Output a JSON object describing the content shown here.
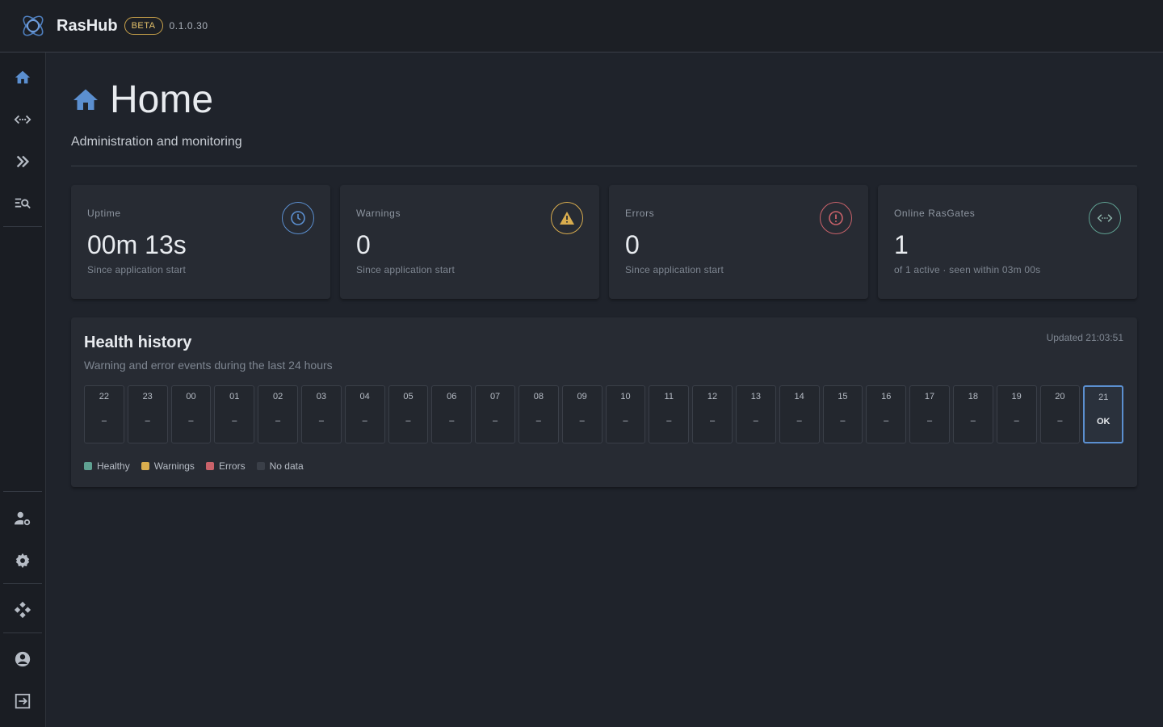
{
  "app": {
    "name": "RasHub",
    "badge": "BETA",
    "version": "0.1.0.30"
  },
  "sidebar": {
    "items": [
      {
        "icon": "home-icon",
        "name": "Home"
      },
      {
        "icon": "gateway-icon",
        "name": "Gateways"
      },
      {
        "icon": "double-chevron-right-icon",
        "name": "Forwarding"
      },
      {
        "icon": "log-search-icon",
        "name": "Logs"
      },
      {
        "icon": "user-settings-icon",
        "name": "User management"
      },
      {
        "icon": "gear-icon",
        "name": "Settings"
      },
      {
        "icon": "hub-network-icon",
        "name": "Network"
      },
      {
        "icon": "account-icon",
        "name": "Account"
      },
      {
        "icon": "logout-icon",
        "name": "Logout"
      }
    ],
    "active_index": 0
  },
  "page": {
    "title": "Home",
    "subtitle": "Administration and monitoring"
  },
  "cards": [
    {
      "label": "Uptime",
      "value": "00m 13s",
      "sub": "Since application start",
      "icon": "clock-icon",
      "color": "#5b8fd0"
    },
    {
      "label": "Warnings",
      "value": "0",
      "sub": "Since application start",
      "icon": "warning-icon",
      "color": "#d9ad4e"
    },
    {
      "label": "Errors",
      "value": "0",
      "sub": "Since application start",
      "icon": "error-icon",
      "color": "#c9626a"
    },
    {
      "label": "Online RasGates",
      "value": "1",
      "sub": "of 1 active · seen within 03m 00s",
      "icon": "gateway-icon",
      "color": "#5fa192"
    }
  ],
  "health": {
    "title": "Health history",
    "subtitle": "Warning and error events during the last 24 hours",
    "updated": "Updated 21:03:51",
    "hours": [
      {
        "hour": "22",
        "status": "–"
      },
      {
        "hour": "23",
        "status": "–"
      },
      {
        "hour": "00",
        "status": "–"
      },
      {
        "hour": "01",
        "status": "–"
      },
      {
        "hour": "02",
        "status": "–"
      },
      {
        "hour": "03",
        "status": "–"
      },
      {
        "hour": "04",
        "status": "–"
      },
      {
        "hour": "05",
        "status": "–"
      },
      {
        "hour": "06",
        "status": "–"
      },
      {
        "hour": "07",
        "status": "–"
      },
      {
        "hour": "08",
        "status": "–"
      },
      {
        "hour": "09",
        "status": "–"
      },
      {
        "hour": "10",
        "status": "–"
      },
      {
        "hour": "11",
        "status": "–"
      },
      {
        "hour": "12",
        "status": "–"
      },
      {
        "hour": "13",
        "status": "–"
      },
      {
        "hour": "14",
        "status": "–"
      },
      {
        "hour": "15",
        "status": "–"
      },
      {
        "hour": "16",
        "status": "–"
      },
      {
        "hour": "17",
        "status": "–"
      },
      {
        "hour": "18",
        "status": "–"
      },
      {
        "hour": "19",
        "status": "–"
      },
      {
        "hour": "20",
        "status": "–"
      },
      {
        "hour": "21",
        "status": "OK",
        "current": true
      }
    ],
    "legend": [
      {
        "label": "Healthy",
        "color": "#5fa192"
      },
      {
        "label": "Warnings",
        "color": "#d9ad4e"
      },
      {
        "label": "Errors",
        "color": "#c9626a"
      },
      {
        "label": "No data",
        "color": "#3a3f48"
      }
    ]
  }
}
